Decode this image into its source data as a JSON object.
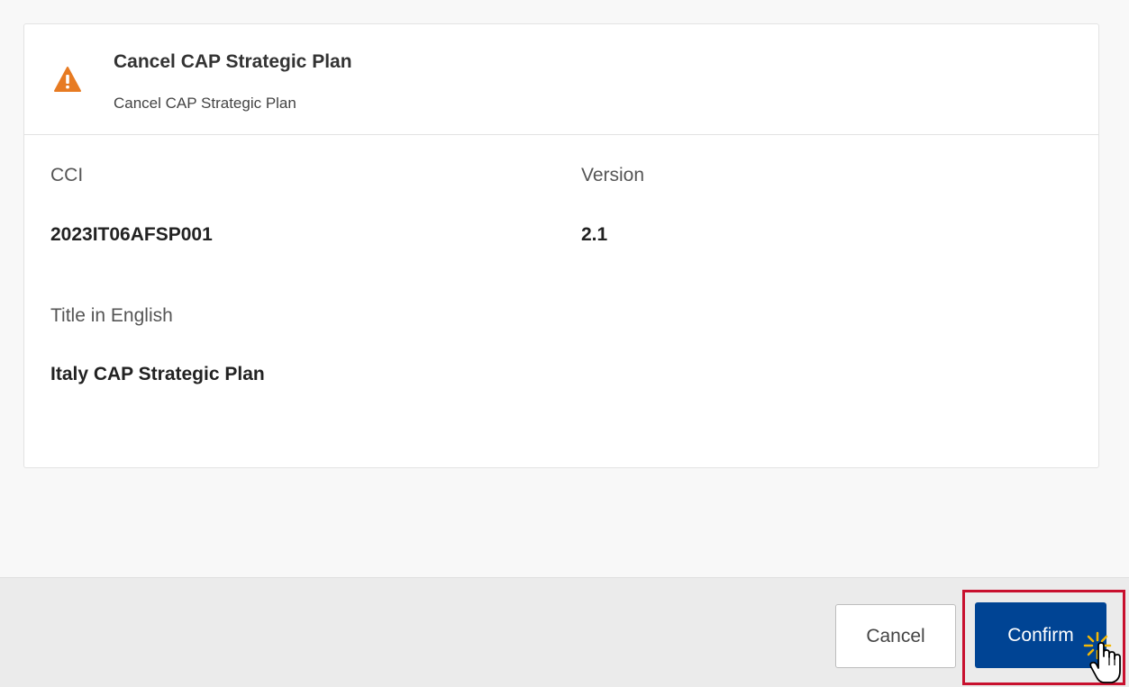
{
  "dialog": {
    "title": "Cancel CAP Strategic Plan",
    "subtitle": "Cancel CAP Strategic Plan",
    "icon": "warning-triangle-icon",
    "warning_color": "#e77b22"
  },
  "fields": {
    "cci": {
      "label": "CCI",
      "value": "2023IT06AFSP001"
    },
    "version": {
      "label": "Version",
      "value": "2.1"
    },
    "title_en": {
      "label": "Title in English",
      "value": "Italy CAP Strategic Plan"
    }
  },
  "footer": {
    "cancel_label": "Cancel",
    "confirm_label": "Confirm",
    "confirm_color": "#004494",
    "highlight_color": "#c8102e"
  }
}
